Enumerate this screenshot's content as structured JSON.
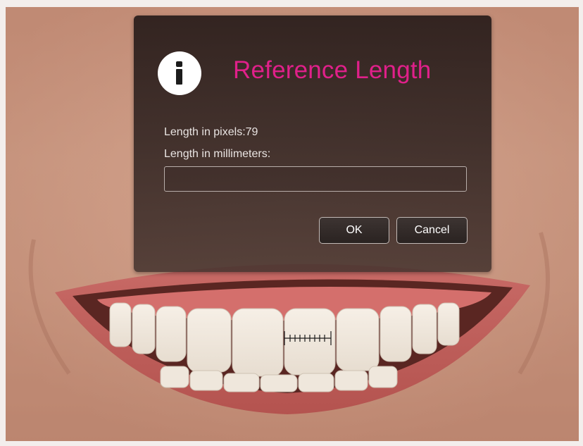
{
  "dialog": {
    "title": "Reference Length",
    "icon": "info-icon",
    "title_color": "#e0208a",
    "pixels_label": "Length in pixels:79",
    "mm_label": "Length in millimeters:",
    "mm_value": "",
    "ok_label": "OK",
    "cancel_label": "Cancel"
  },
  "background": {
    "subject": "smile-photo",
    "overlay": "measurement-ruler"
  }
}
